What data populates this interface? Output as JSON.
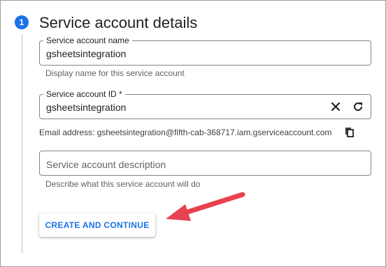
{
  "step": {
    "number": "1",
    "title": "Service account details"
  },
  "service_account_name": {
    "label": "Service account name",
    "value": "gsheetsintegration",
    "hint": "Display name for this service account"
  },
  "service_account_id": {
    "label": "Service account ID *",
    "value": "gsheetsintegration",
    "clear_icon": "close-icon",
    "regenerate_icon": "refresh-icon"
  },
  "email": {
    "text": "Email address: gsheetsintegration@fifth-cab-368717.iam.gserviceaccount.com",
    "copy_icon": "copy-icon"
  },
  "description": {
    "placeholder": "Service account description",
    "hint": "Describe what this service account will do"
  },
  "actions": {
    "create_continue_label": "CREATE AND CONTINUE"
  },
  "colors": {
    "accent": "#1a73e8",
    "annotation_arrow": "#e8414f"
  }
}
